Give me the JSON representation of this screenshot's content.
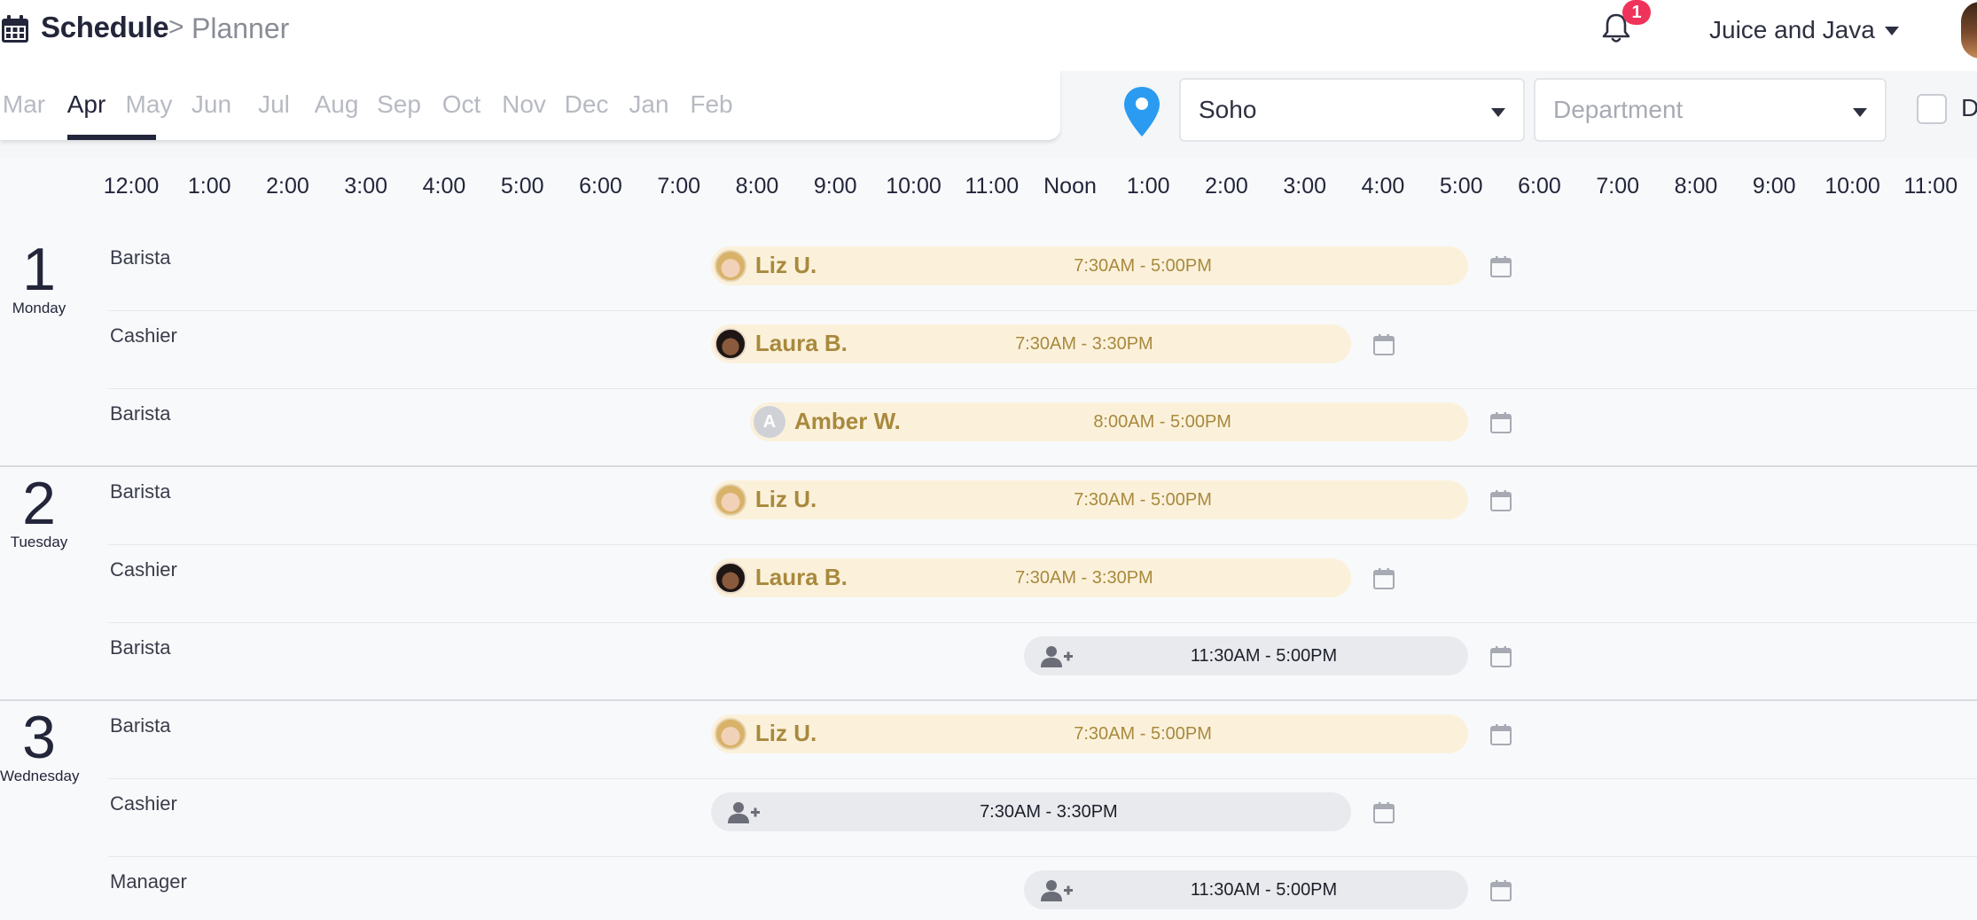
{
  "header": {
    "title": "Schedule",
    "breadcrumb_sep": ">",
    "breadcrumb": "Planner",
    "notification_count": "1",
    "org_name": "Juice and Java"
  },
  "toolbar": {
    "months": [
      "Mar",
      "Apr",
      "May",
      "Jun",
      "Jul",
      "Aug",
      "Sep",
      "Oct",
      "Nov",
      "Dec",
      "Jan",
      "Feb"
    ],
    "active_month": "Apr",
    "location": "Soho",
    "department_placeholder": "Department",
    "checkbox_label": "D"
  },
  "hours": [
    "12:00",
    "1:00",
    "2:00",
    "3:00",
    "4:00",
    "5:00",
    "6:00",
    "7:00",
    "8:00",
    "9:00",
    "10:00",
    "11:00",
    "Noon",
    "1:00",
    "2:00",
    "3:00",
    "4:00",
    "5:00",
    "6:00",
    "7:00",
    "8:00",
    "9:00",
    "10:00",
    "11:00"
  ],
  "days": [
    {
      "num": "1",
      "name": "Monday",
      "rows": [
        {
          "role": "Barista",
          "employee": "Liz U.",
          "avatar": "blonde",
          "time": "7:30AM - 5:00PM"
        },
        {
          "role": "Cashier",
          "employee": "Laura B.",
          "avatar": "dark",
          "time": "7:30AM - 3:30PM"
        },
        {
          "role": "Barista",
          "employee": "Amber W.",
          "avatar": "letter",
          "avatar_letter": "A",
          "time": "8:00AM - 5:00PM"
        }
      ]
    },
    {
      "num": "2",
      "name": "Tuesday",
      "rows": [
        {
          "role": "Barista",
          "employee": "Liz U.",
          "avatar": "blonde",
          "time": "7:30AM - 5:00PM"
        },
        {
          "role": "Cashier",
          "employee": "Laura B.",
          "avatar": "dark",
          "time": "7:30AM - 3:30PM"
        },
        {
          "role": "Barista",
          "employee": "",
          "avatar": "open",
          "time": "11:30AM - 5:00PM"
        }
      ]
    },
    {
      "num": "3",
      "name": "Wednesday",
      "rows": [
        {
          "role": "Barista",
          "employee": "Liz U.",
          "avatar": "blonde",
          "time": "7:30AM - 5:00PM"
        },
        {
          "role": "Cashier",
          "employee": "",
          "avatar": "open",
          "time": "7:30AM - 3:30PM"
        },
        {
          "role": "Manager",
          "employee": "",
          "avatar": "open",
          "time": "11:30AM - 5:00PM"
        }
      ]
    }
  ],
  "icons": {
    "header_calendar": "calendar-icon",
    "notifications": "bell-icon",
    "org_menu": "caret-down-icon",
    "location": "map-pin-icon",
    "open_shift": "user-plus-icon",
    "shift_calendar": "calendar-icon"
  },
  "colors": {
    "assigned_shift_bg": "#fbf1db",
    "assigned_shift_text": "#a8893d",
    "open_shift_bg": "#e8eaed",
    "badge": "#f0335a",
    "pin": "#2a9bf0",
    "title": "#23263a"
  }
}
